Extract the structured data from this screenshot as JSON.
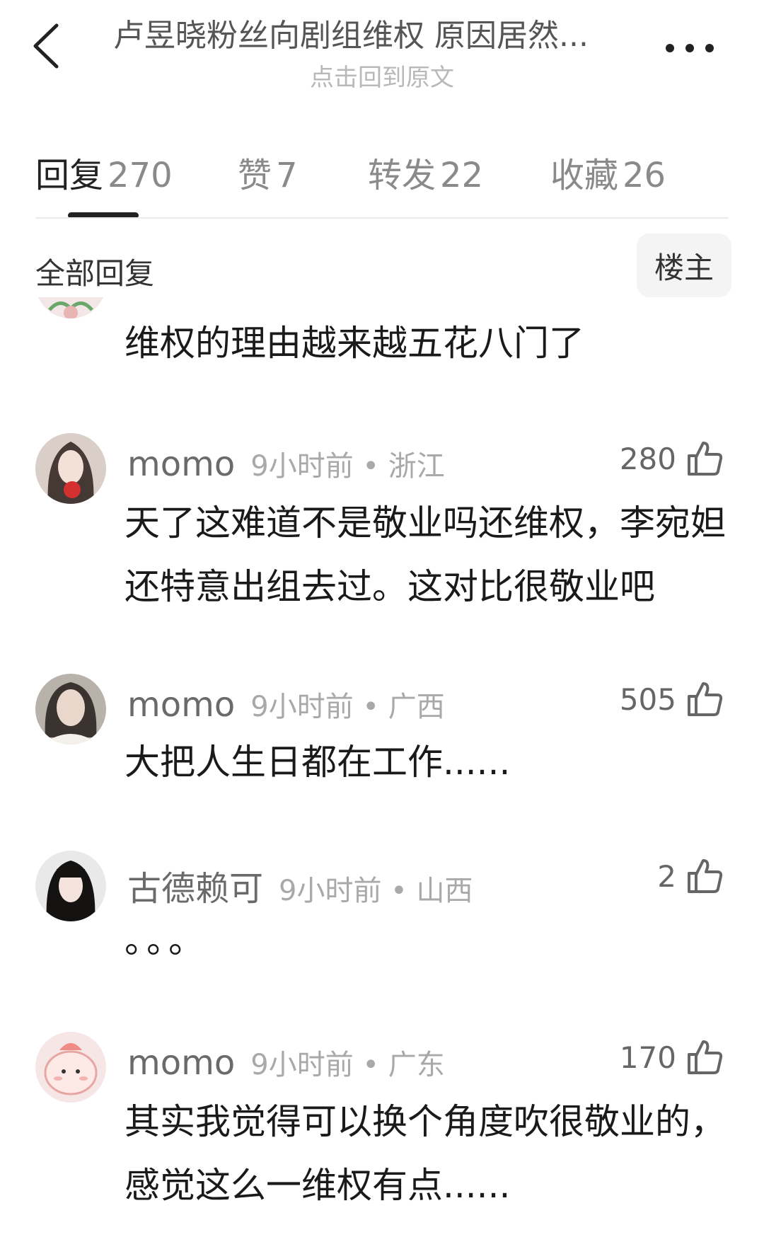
{
  "header": {
    "title": "卢昱晓粉丝向剧组维权 原因居然...",
    "subtitle": "点击回到原文"
  },
  "tabs": [
    {
      "label": "回复",
      "count": "270"
    },
    {
      "label": "赞",
      "count": "7"
    },
    {
      "label": "转发",
      "count": "22"
    },
    {
      "label": "收藏",
      "count": "26"
    }
  ],
  "filter": {
    "label": "全部回复",
    "op_button": "楼主"
  },
  "comments": [
    {
      "text": "维权的理由越来越五花八门了"
    },
    {
      "user": "momo",
      "time": "9小时前 • 浙江",
      "likes": "280",
      "text": "天了这难道不是敬业吗还维权，李宛妲还特意出组去过。这对比很敬业吧"
    },
    {
      "user": "momo",
      "time": "9小时前 • 广西",
      "likes": "505",
      "text": "大把人生日都在工作......"
    },
    {
      "user": "古德赖可",
      "time": "9小时前 • 山西",
      "likes": "2",
      "text": "。。。"
    },
    {
      "user": "momo",
      "time": "9小时前 • 广东",
      "likes": "170",
      "text": "其实我觉得可以换个角度吹很敬业的，感觉这么一维权有点......"
    }
  ],
  "icons": {
    "back": "chevron-left-icon",
    "more": "more-dots-icon",
    "like": "thumbs-up-icon"
  }
}
